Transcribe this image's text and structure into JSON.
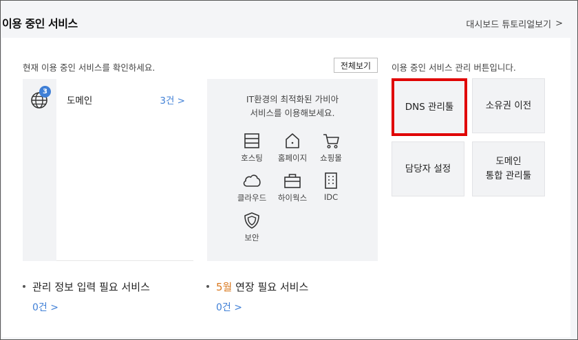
{
  "header": {
    "title": "이용 중인 서비스",
    "tutorial_link": "대시보드 튜토리얼보기",
    "tutorial_chevron": ">"
  },
  "left_section": {
    "description": "현재 이용 중인 서비스를 확인하세요.",
    "view_all_label": "전체보기",
    "domain": {
      "label": "도메인",
      "badge": "3",
      "count_link": "3건 >"
    }
  },
  "promo": {
    "line1": "IT환경의 최적화된 가비아",
    "line2": "서비스를 이용해보세요.",
    "services": [
      {
        "name": "hosting",
        "icon": "server-icon",
        "label": "호스팅"
      },
      {
        "name": "homepage",
        "icon": "home-icon",
        "label": "홈페이지"
      },
      {
        "name": "shopping",
        "icon": "cart-icon",
        "label": "쇼핑몰"
      },
      {
        "name": "cloud",
        "icon": "cloud-icon",
        "label": "클라우드"
      },
      {
        "name": "hiworks",
        "icon": "briefcase-icon",
        "label": "하이웍스"
      },
      {
        "name": "idc",
        "icon": "building-icon",
        "label": "IDC"
      },
      {
        "name": "security",
        "icon": "shield-icon",
        "label": "보안"
      }
    ]
  },
  "right_section": {
    "description": "이용 중인 서비스 관리 버튼입니다.",
    "buttons": [
      {
        "label": "DNS 관리툴",
        "highlighted": true
      },
      {
        "label": "소유권 이전"
      },
      {
        "label": "담당자 설정"
      },
      {
        "label_line1": "도메인",
        "label_line2": "통합 관리툴"
      }
    ]
  },
  "pending": {
    "info_needed": {
      "label": "관리 정보 입력 필요 서비스",
      "count": "0건 >"
    },
    "renewal": {
      "month": "5월",
      "label": " 연장 필요 서비스",
      "count": "0건 >"
    }
  },
  "colors": {
    "accent_blue": "#3f7fd6",
    "accent_orange": "#d9781e",
    "highlight_red": "#e00000"
  }
}
